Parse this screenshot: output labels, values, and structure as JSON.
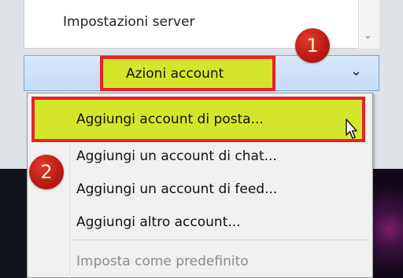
{
  "server_list": {
    "item": "Impostazioni server",
    "scroll_icon": "chevron-down-icon"
  },
  "actions_button": {
    "label": "Azioni account",
    "icon": "chevron-down-icon"
  },
  "menu": {
    "items": [
      {
        "label": "Aggiungi account di posta...",
        "highlighted": true
      },
      {
        "label": "Aggiungi un account di chat..."
      },
      {
        "label": "Aggiungi un account di feed..."
      },
      {
        "label": "Aggiungi altro account..."
      },
      {
        "label": "Imposta come predefinito",
        "disabled": true
      }
    ]
  },
  "annotations": {
    "badge1": "1",
    "badge2": "2",
    "highlight_color": "#d4e62c",
    "box_color": "#e8202a",
    "badge_color": "#c4201a"
  }
}
